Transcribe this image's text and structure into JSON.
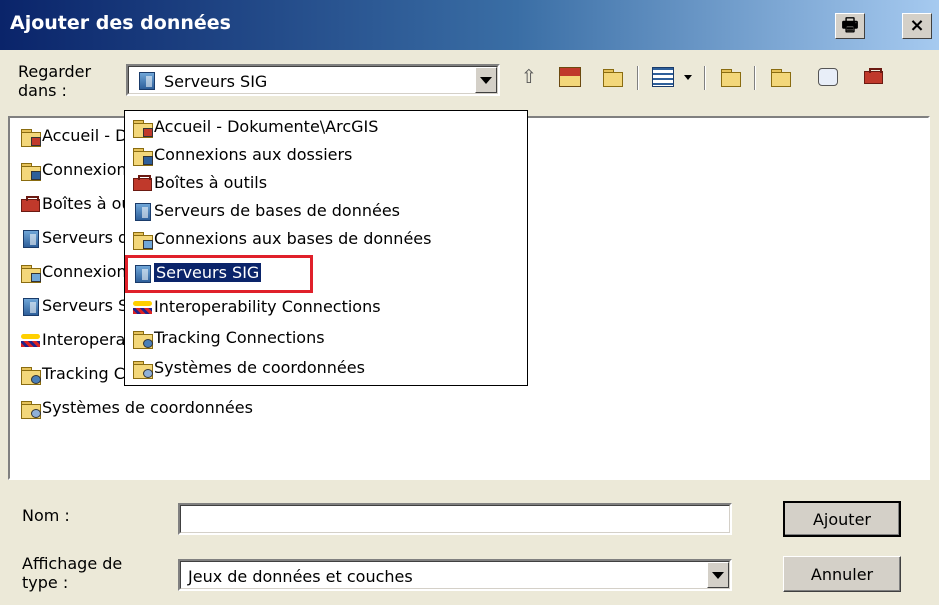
{
  "window": {
    "title": "Ajouter des données",
    "print_glyph": "🖶",
    "close_glyph": "×"
  },
  "look_in": {
    "label_line1": "Regarder",
    "label_line2": "dans :",
    "value": "Serveurs SIG",
    "value_icon": "server-icon"
  },
  "toolbar": {
    "icons": [
      "up-one-level-icon",
      "home-icon",
      "connect-to-folder-icon",
      "view-options-icon",
      "add-gis-server-icon",
      "new-folder-icon",
      "new-database-icon",
      "toolbox-icon"
    ]
  },
  "list": {
    "items": [
      {
        "label": "Accueil - Dokumente\\ArcGIS",
        "icon": "home-folder-icon"
      },
      {
        "label": "Connexions aux dossiers",
        "icon": "folder-connection-icon"
      },
      {
        "label": "Boîtes à outils",
        "icon": "toolbox-icon"
      },
      {
        "label": "Serveurs de bases de données",
        "icon": "database-server-icon"
      },
      {
        "label": "Connexions aux bases de données",
        "icon": "database-connection-icon"
      },
      {
        "label": "Serveurs SIG",
        "icon": "gis-server-icon"
      },
      {
        "label": "Interoperability Connections",
        "icon": "interoperability-icon"
      },
      {
        "label": "Tracking Connections",
        "icon": "tracking-connection-icon"
      },
      {
        "label": "Systèmes de coordonnées",
        "icon": "coordinate-system-icon"
      }
    ]
  },
  "dropdown": {
    "selected_index": 5,
    "items": [
      {
        "label": "Accueil - Dokumente\\ArcGIS"
      },
      {
        "label": "Connexions aux dossiers"
      },
      {
        "label": "Boîtes à outils"
      },
      {
        "label": "Serveurs de bases de données"
      },
      {
        "label": "Connexions aux bases de données"
      },
      {
        "label": "Serveurs SIG"
      },
      {
        "label": "Interoperability Connections"
      },
      {
        "label": "Tracking Connections"
      },
      {
        "label": "Systèmes de coordonnées"
      }
    ]
  },
  "name_field": {
    "label": "Nom :",
    "value": ""
  },
  "type_field": {
    "label_line1": "Affichage de",
    "label_line2": "type :",
    "value": "Jeux de données et couches"
  },
  "buttons": {
    "add": "Ajouter",
    "cancel": "Annuler"
  },
  "colors": {
    "title_bar": "#0a246a",
    "selection": "#0a246a",
    "highlight_box": "#e0202a",
    "dialog_bg": "#ece9d8"
  }
}
